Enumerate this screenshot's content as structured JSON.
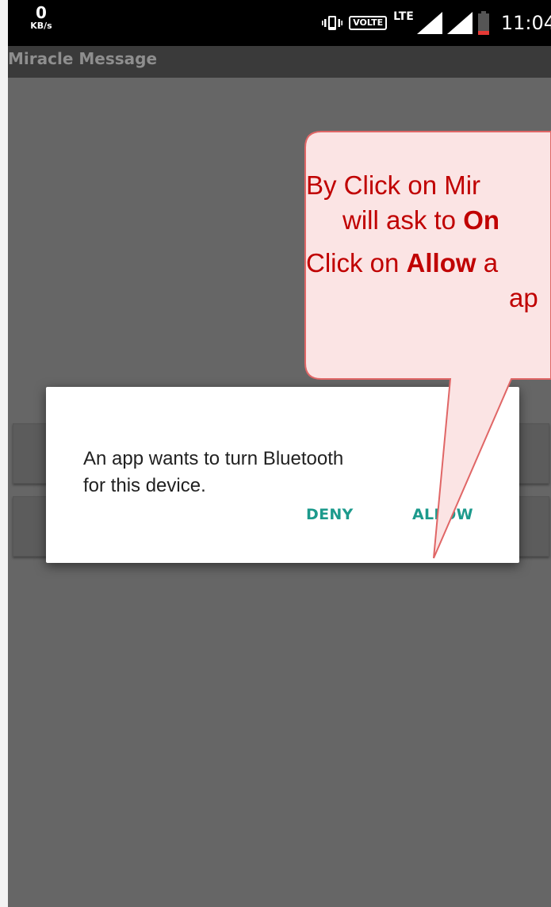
{
  "status_bar": {
    "speed_value": "0",
    "speed_unit": "KB/s",
    "network_badge": "VOLTE",
    "network_type": "LTE",
    "time": "11:04",
    "icons": [
      "vibrate-icon",
      "volte-badge",
      "signal-icon",
      "signal-icon",
      "battery-icon"
    ],
    "battery_color": "#e53935"
  },
  "app_bar": {
    "title": "Miracle Message"
  },
  "dialog": {
    "message_line1": "An app wants to turn Bluetooth",
    "message_line2": "for this device.",
    "deny_label": "DENY",
    "allow_label": "ALLOW",
    "accent_color": "#1c9a8c"
  },
  "callout": {
    "line1": "By Click on Mir",
    "line2_prefix": "will ask to ",
    "line2_bold": "On",
    "line3_prefix": "Click on ",
    "line3_bold": "Allow",
    "line3_suffix": " a",
    "line4": "ap",
    "text_color": "#c00000",
    "fill_color": "#fbe4e4",
    "border_color": "#e06666"
  }
}
